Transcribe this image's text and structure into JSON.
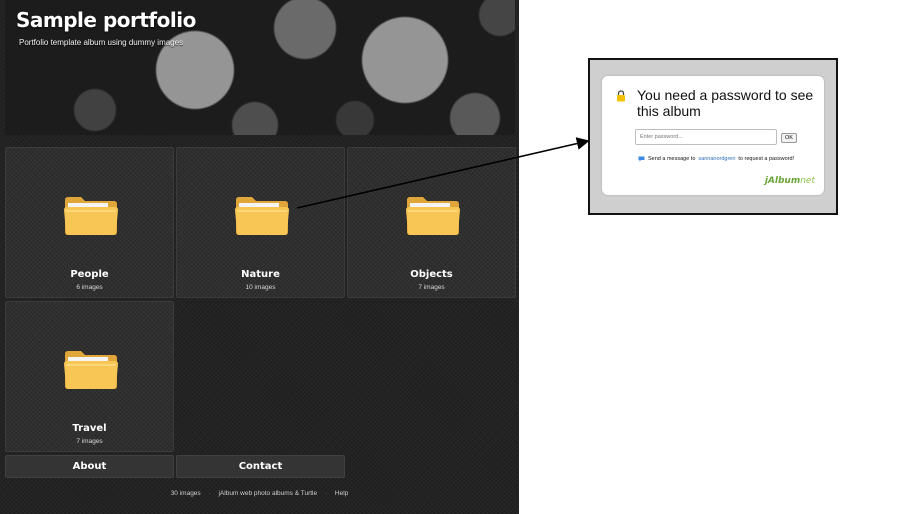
{
  "album": {
    "title": "Sample portfolio",
    "subtitle": "Portfolio template album using dummy images",
    "folders": [
      {
        "name": "People",
        "count": "6 images"
      },
      {
        "name": "Nature",
        "count": "10 images"
      },
      {
        "name": "Objects",
        "count": "7 images"
      },
      {
        "name": "Travel",
        "count": "7 images"
      }
    ],
    "nav": {
      "about": "About",
      "contact": "Contact"
    },
    "footer": {
      "images_total": "30 images",
      "separator": "·",
      "credit": "jAlbum web photo albums & Turtle",
      "help": "Help"
    }
  },
  "password_dialog": {
    "title": "You need a password to see this album",
    "input_placeholder": "Enter password...",
    "ok_label": "OK",
    "message_prefix": "Send a message to",
    "message_user": "sannanordgren",
    "message_suffix": "to request a password!",
    "brand_part1": "jAlbum",
    "brand_part2": "net",
    "lock_icon": "lock-icon",
    "chat_icon": "chat-icon"
  },
  "colors": {
    "folder": "#f7c24a",
    "lock": "#f2c200",
    "brand": "#6aa53a",
    "link": "#2c6fb3"
  }
}
